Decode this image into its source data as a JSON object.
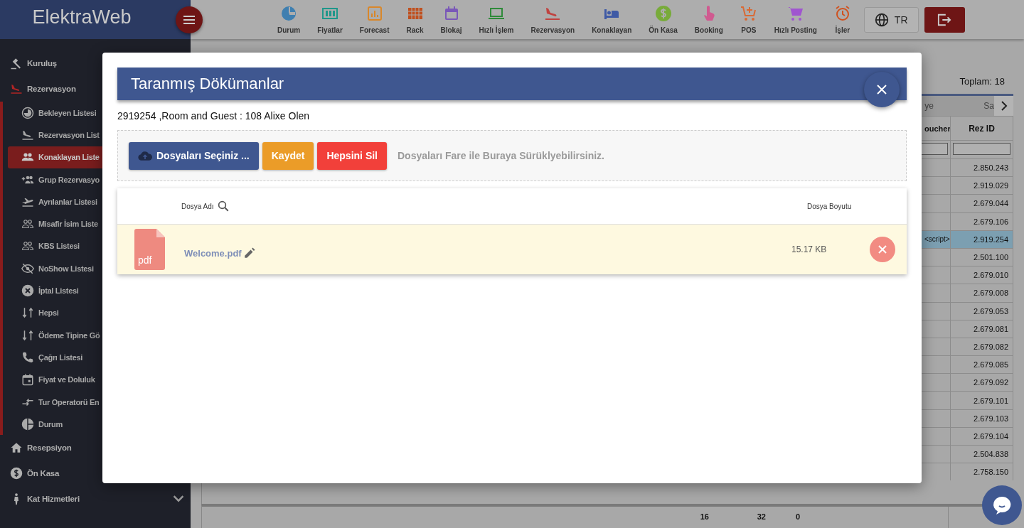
{
  "header": {
    "logo": "ElektraWeb",
    "language": "TR",
    "toolbar": [
      {
        "label": "Durum",
        "color": "#3f7fb0"
      },
      {
        "label": "Fiyatlar",
        "color": "#1f978a"
      },
      {
        "label": "Forecast",
        "color": "#d9872a"
      },
      {
        "label": "Rack",
        "color": "#c0501f"
      },
      {
        "label": "Blokaj",
        "color": "#7a58b8"
      },
      {
        "label": "Hızlı İşlem",
        "color": "#2f8a3a"
      },
      {
        "label": "Rezervasyon",
        "color": "#c0423f"
      },
      {
        "label": "Konaklayan",
        "color": "#3f5aa5"
      },
      {
        "label": "Ön Kasa",
        "color": "#78ab3a"
      },
      {
        "label": "Booking",
        "color": "#d05a90"
      },
      {
        "label": "POS",
        "color": "#d96a35"
      },
      {
        "label": "Hızlı Posting",
        "color": "#a055d0"
      },
      {
        "label": "İşler",
        "color": "#d0521f"
      }
    ]
  },
  "sidebar": {
    "items": [
      {
        "label": "Kuruluş",
        "selected": false
      },
      {
        "label": "Rezervasyon",
        "selected": true,
        "expanded": true,
        "children": [
          {
            "label": "Bekleyen Listesi",
            "selected": false
          },
          {
            "label": "Rezervasyon List",
            "selected": false
          },
          {
            "label": "Konaklayan Liste",
            "selected": true
          },
          {
            "label": "Grup Rezervasyo",
            "selected": false
          },
          {
            "label": "Ayrılanlar Listesi",
            "selected": false
          },
          {
            "label": "Misafir İsim Liste",
            "selected": false
          },
          {
            "label": "KBS Listesi",
            "selected": false
          },
          {
            "label": "NoShow Listesi",
            "selected": false
          },
          {
            "label": "İptal Listesi",
            "selected": false
          },
          {
            "label": "Hepsi",
            "selected": false
          },
          {
            "label": "Ödeme Tipine Gö",
            "selected": false
          },
          {
            "label": "Çağrı Listesi",
            "selected": false
          },
          {
            "label": "Fiyat ve Doluluk",
            "selected": false
          },
          {
            "label": "Tur Operatorü En",
            "selected": false
          },
          {
            "label": "Durum",
            "selected": false
          }
        ]
      },
      {
        "label": "Resepsiyon",
        "selected": false
      },
      {
        "label": "Ön Kasa",
        "selected": false
      },
      {
        "label": "Kat Hizmetleri",
        "selected": false,
        "expanded": false
      }
    ]
  },
  "table": {
    "total": "Toplam: 18",
    "tabs": [
      {
        "label": "ye",
        "selected": false
      },
      {
        "label": "Sa",
        "selected": false
      }
    ],
    "columns": [
      "oucher",
      "Rez ID"
    ],
    "rows": [
      {
        "rez_id": "2.850.243",
        "selected": false
      },
      {
        "rez_id": "2.919.029",
        "selected": false
      },
      {
        "rez_id": "2.679.044",
        "selected": false
      },
      {
        "rez_id": "2.679.106",
        "selected": false
      },
      {
        "column_1": "<script>",
        "rez_id": "2.919.254",
        "selected": true
      },
      {
        "rez_id": "2.501.100",
        "selected": false
      },
      {
        "rez_id": "2.679.010",
        "selected": false
      },
      {
        "rez_id": "2.679.008",
        "selected": false
      },
      {
        "rez_id": "2.679.053",
        "selected": false
      },
      {
        "rez_id": "2.679.081",
        "selected": false
      },
      {
        "rez_id": "2.679.082",
        "selected": false
      },
      {
        "rez_id": "2.679.085",
        "selected": false
      },
      {
        "rez_id": "2.679.092",
        "selected": false
      },
      {
        "rez_id": "2.679.101",
        "selected": false
      },
      {
        "rez_id": "2.679.103",
        "selected": false
      },
      {
        "rez_id": "2.679.104",
        "selected": false
      },
      {
        "rez_id": "2.504.838",
        "selected": false
      },
      {
        "rez_id": "2.758.150",
        "selected": false
      }
    ],
    "totals": [
      "16",
      "32",
      "0"
    ]
  },
  "modal": {
    "title": "Taranmış Dökümanlar",
    "subtitle": "2919254 ,Room and Guest : 108 Alixe Olen",
    "buttons": [
      {
        "label": "Dosyaları Seçiniz ...",
        "kind": "upload"
      },
      {
        "label": "Kaydet",
        "kind": "save"
      },
      {
        "label": "Hepsini Sil",
        "kind": "delete"
      }
    ],
    "drop_hint": "Dosyaları Fare ile Buraya Sürüklyebilirsiniz.",
    "columns": [
      "Dosya Adı",
      "Dosya Boyutu"
    ],
    "files": [
      {
        "type": "pdf",
        "name": "Welcome.pdf",
        "size": "15.17 KB"
      }
    ]
  }
}
